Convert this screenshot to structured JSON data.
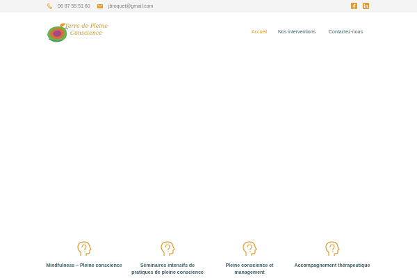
{
  "topbar": {
    "phone": "06 87 55 51 60",
    "email": "jbroquet@gmail.com",
    "phone_icon": "phone-icon",
    "email_icon": "envelope-icon",
    "social": [
      "facebook-icon",
      "linkedin-icon"
    ]
  },
  "logo": {
    "line1": "Terre de Pleine",
    "line2": "Conscience"
  },
  "nav": {
    "items": [
      "Accueil",
      "Nos interventions",
      "Contactez-nous"
    ],
    "active": "Accueil"
  },
  "services": [
    {
      "title": "Mindfulness – Pleine conscience",
      "icon": "head-icon"
    },
    {
      "title": "Séminaires intensifs de pratiques de pleine conscience",
      "icon": "head-icon"
    },
    {
      "title": "Pleine conscience et management",
      "icon": "head-icon"
    },
    {
      "title": "Accompagnement thérapeutique",
      "icon": "head-icon"
    }
  ],
  "colors": {
    "accent": "#e39a2b",
    "nav_text": "#3f5f62",
    "topbar_bg": "#f4f4f4",
    "topbar_text": "#7a7a7a",
    "logo_text": "#c99a2a"
  }
}
